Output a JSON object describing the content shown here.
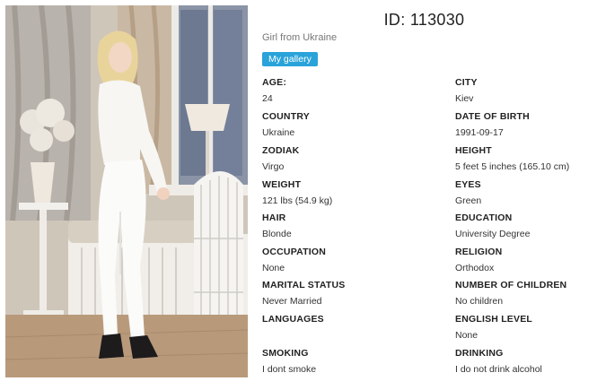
{
  "profile": {
    "id_label": "ID: 113030",
    "subtitle": "Girl from Ukraine",
    "gallery_button": "My gallery"
  },
  "fields": [
    {
      "label": "AGE:",
      "value": "24"
    },
    {
      "label": "CITY",
      "value": "Kiev"
    },
    {
      "label": "COUNTRY",
      "value": "Ukraine"
    },
    {
      "label": "DATE OF BIRTH",
      "value": "1991-09-17"
    },
    {
      "label": "ZODIAK",
      "value": "Virgo"
    },
    {
      "label": "HEIGHT",
      "value": "5 feet 5 inches (165.10 cm)"
    },
    {
      "label": "WEIGHT",
      "value": "121 lbs (54.9 kg)"
    },
    {
      "label": "EYES",
      "value": "Green"
    },
    {
      "label": "HAIR",
      "value": "Blonde"
    },
    {
      "label": "EDUCATION",
      "value": "University Degree"
    },
    {
      "label": "OCCUPATION",
      "value": "None"
    },
    {
      "label": "RELIGION",
      "value": "Orthodox"
    },
    {
      "label": "MARITAL STATUS",
      "value": "Never Married"
    },
    {
      "label": "NUMBER OF CHILDREN",
      "value": "No children"
    },
    {
      "label": "LANGUAGES",
      "value": ""
    },
    {
      "label": "ENGLISH LEVEL",
      "value": "None"
    },
    {
      "label": "SMOKING",
      "value": "I dont smoke"
    },
    {
      "label": "DRINKING",
      "value": "I do not drink alcohol"
    }
  ],
  "colors": {
    "accent": "#29a3d9"
  }
}
